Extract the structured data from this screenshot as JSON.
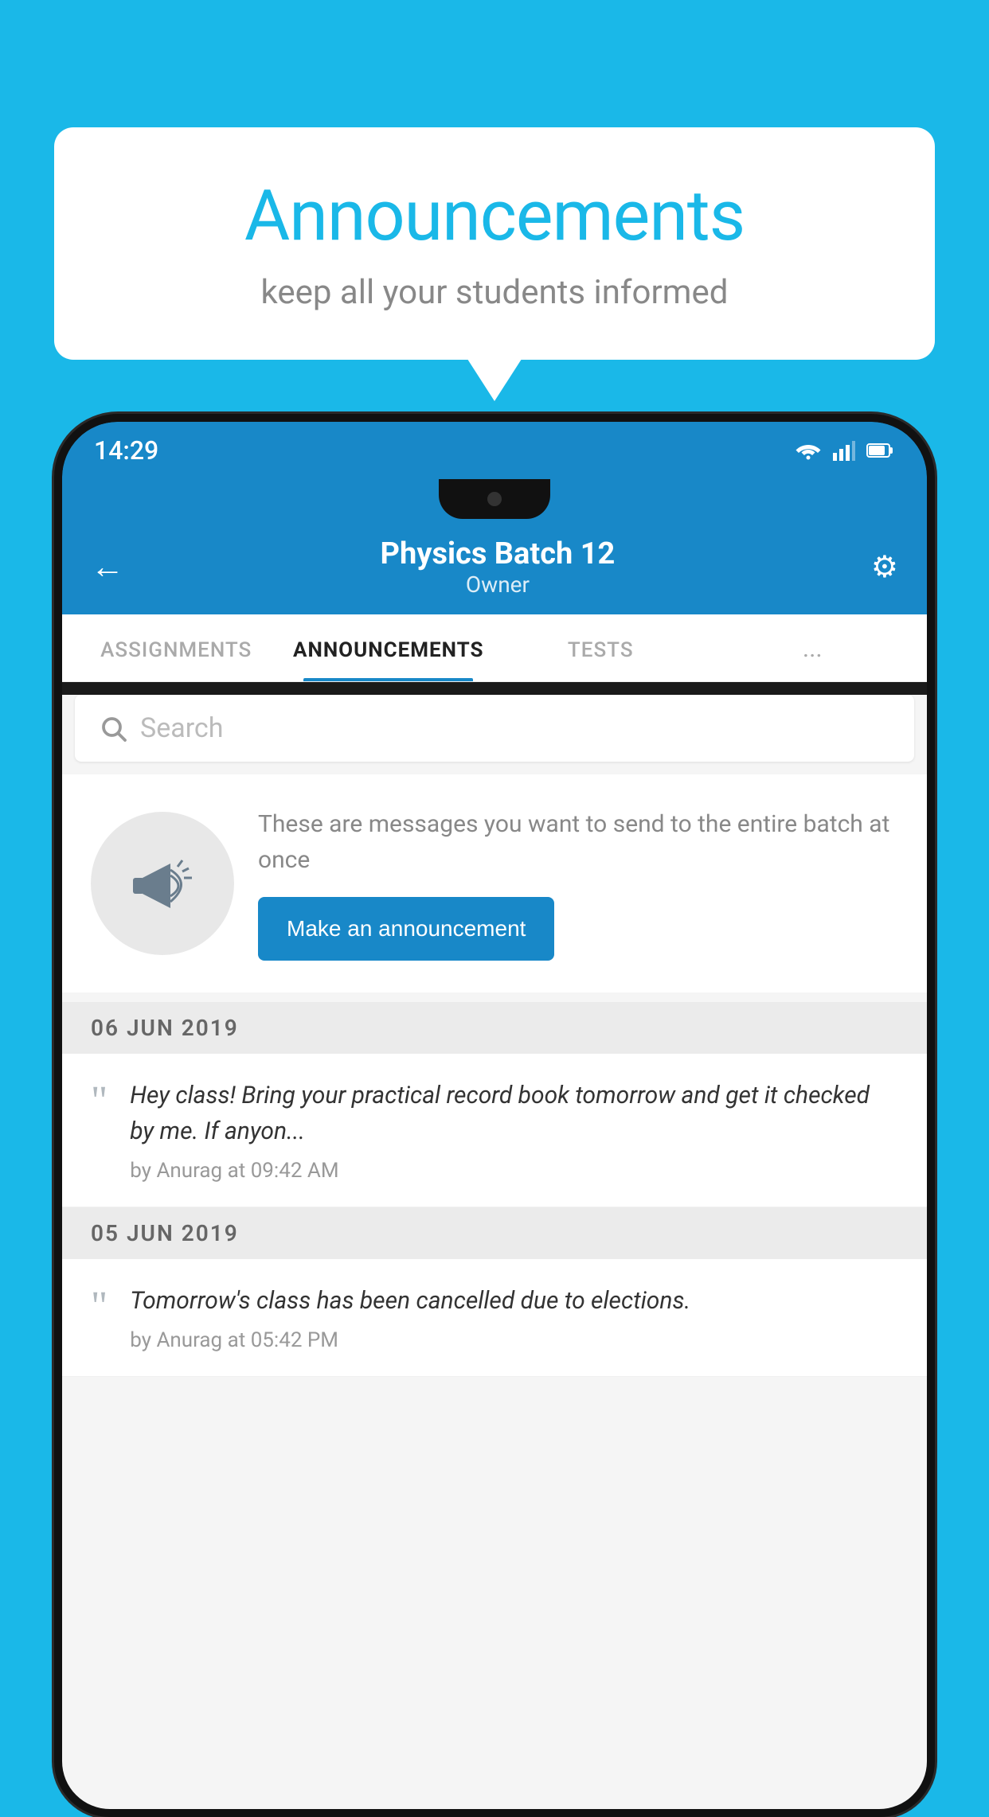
{
  "background": {
    "color": "#1ab8e8"
  },
  "speech_bubble": {
    "title": "Announcements",
    "subtitle": "keep all your students informed"
  },
  "status_bar": {
    "time": "14:29"
  },
  "app_header": {
    "title": "Physics Batch 12",
    "subtitle": "Owner",
    "back_label": "←",
    "settings_label": "⚙"
  },
  "tabs": [
    {
      "label": "ASSIGNMENTS",
      "active": false
    },
    {
      "label": "ANNOUNCEMENTS",
      "active": true
    },
    {
      "label": "TESTS",
      "active": false
    },
    {
      "label": "...",
      "active": false
    }
  ],
  "search": {
    "placeholder": "Search"
  },
  "promo": {
    "description": "These are messages you want to send to the entire batch at once",
    "button_label": "Make an announcement"
  },
  "announcements": [
    {
      "date": "06  JUN  2019",
      "message": "Hey class! Bring your practical record book tomorrow and get it checked by me. If anyon...",
      "author": "by Anurag at 09:42 AM"
    },
    {
      "date": "05  JUN  2019",
      "message": "Tomorrow's class has been cancelled due to elections.",
      "author": "by Anurag at 05:42 PM"
    }
  ]
}
